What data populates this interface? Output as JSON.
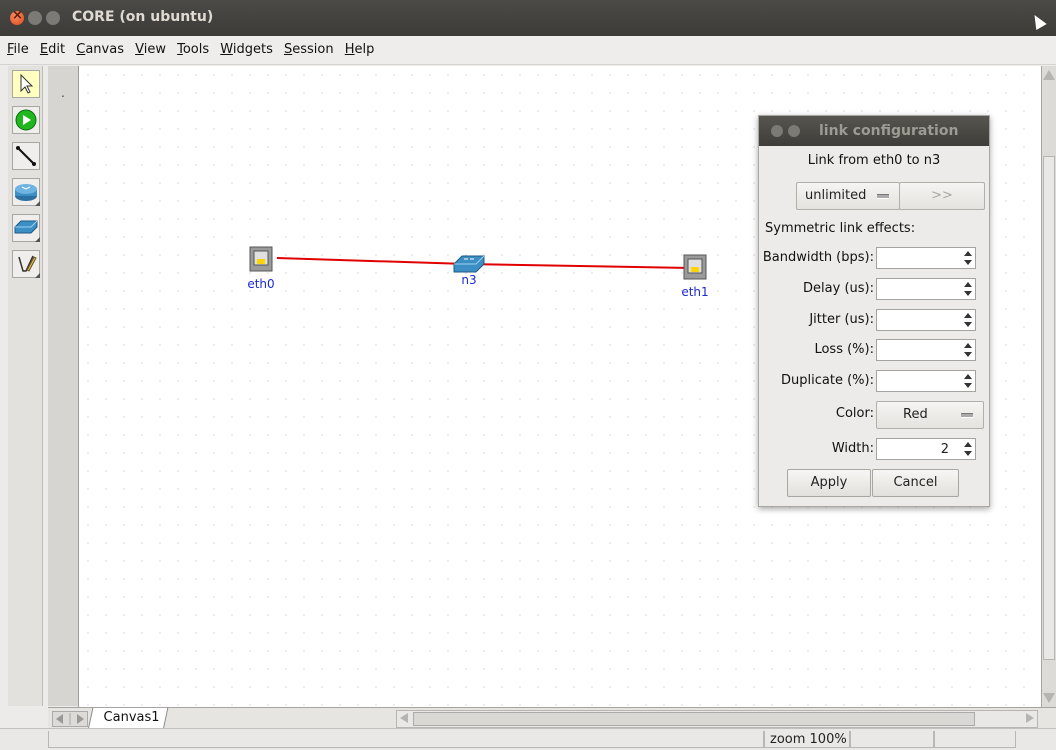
{
  "window": {
    "title": "CORE (on ubuntu)"
  },
  "menu": [
    "File",
    "Edit",
    "Canvas",
    "View",
    "Tools",
    "Widgets",
    "Session",
    "Help"
  ],
  "tools": [
    "select-tool",
    "start-session-tool",
    "link-tool",
    "router-tool",
    "switch-tool",
    "annotation-tool"
  ],
  "nodes": [
    {
      "id": "eth0",
      "label": "eth0",
      "type": "rj45"
    },
    {
      "id": "n3",
      "label": "n3",
      "type": "switch"
    },
    {
      "id": "eth1",
      "label": "eth1",
      "type": "rj45"
    }
  ],
  "link_color": "#e00000",
  "canvas_tab": "Canvas1",
  "status": {
    "zoom": "zoom 100%"
  },
  "dialog": {
    "title": "link configuration",
    "link_from": "Link from eth0 to n3",
    "preset": "unlimited",
    "preset_next": ">>",
    "section": "Symmetric link effects:",
    "fields": {
      "bandwidth": {
        "label": "Bandwidth (bps):",
        "value": ""
      },
      "delay": {
        "label": "Delay (us):",
        "value": ""
      },
      "jitter": {
        "label": "Jitter (us):",
        "value": ""
      },
      "loss": {
        "label": "Loss (%):",
        "value": ""
      },
      "duplicate": {
        "label": "Duplicate (%):",
        "value": ""
      },
      "color": {
        "label": "Color:",
        "value": "Red"
      },
      "width": {
        "label": "Width:",
        "value": "2"
      }
    },
    "apply": "Apply",
    "cancel": "Cancel"
  }
}
